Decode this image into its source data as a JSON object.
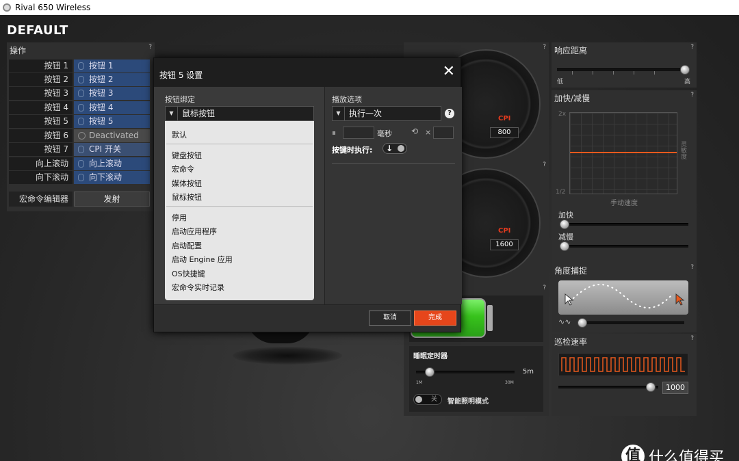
{
  "window": {
    "title": "Rival 650 Wireless"
  },
  "profile": {
    "name": "DEFAULT"
  },
  "help_glyph": "?",
  "operations": {
    "title": "操作",
    "rows": [
      {
        "label": "按钮 1",
        "value": "按钮 1"
      },
      {
        "label": "按钮 2",
        "value": "按钮 2"
      },
      {
        "label": "按钮 3",
        "value": "按钮 3"
      },
      {
        "label": "按钮 4",
        "value": "按钮 4"
      },
      {
        "label": "按钮 5",
        "value": "按钮 5"
      },
      {
        "label": "按钮 6",
        "value": "Deactivated"
      },
      {
        "label": "按钮 7",
        "value": "CPI 开关"
      },
      {
        "label": "向上滚动",
        "value": "向上滚动"
      },
      {
        "label": "向下滚动",
        "value": "向下滚动"
      }
    ],
    "macro_label": "宏命令编辑器",
    "macro_button": "发射"
  },
  "cpi": {
    "label": "CPI",
    "gauge1": "800",
    "gauge2": "1600"
  },
  "sleep": {
    "title": "睡眠定时器",
    "value": "5m",
    "min": "1M",
    "max": "30M",
    "toggle_text": "关",
    "smart_label": "智能照明模式",
    "level": 0.14
  },
  "response": {
    "title": "响应距离",
    "low": "低",
    "high": "高",
    "level": 1.0
  },
  "accel": {
    "title": "加快/减慢",
    "y_top": "2x",
    "y_bottom": "1/2",
    "x_label": "手动速度",
    "y_label": "灵敏度",
    "accel_label": "加快",
    "decel_label": "减慢"
  },
  "angle": {
    "title": "角度捕捉"
  },
  "polling": {
    "title": "巡检速率",
    "value": "1000"
  },
  "dialog": {
    "title": "按钮 5 设置",
    "close": "✕",
    "binding_label": "按钮绑定",
    "binding_value": "鼠标按钮",
    "dropdown_arrow": "▼",
    "dropdown_items": {
      "default": "默认",
      "keyboard": "键盘按钮",
      "macro": "宏命令",
      "media": "媒体按钮",
      "mouse": "鼠标按钮",
      "disable": "停用",
      "launch_app": "启动应用程序",
      "launch_config": "启动配置",
      "launch_engine": "启动 Engine 应用",
      "os_shortcut": "OS快捷键",
      "macro_live": "宏命令实时记录"
    },
    "playback_label": "播放选项",
    "playback_value": "执行一次",
    "ms_label": "毫秒",
    "repeat_x": "×",
    "exec_label": "按键时执行:",
    "cancel": "取消",
    "done": "完成"
  },
  "watermark": {
    "logo": "值",
    "text": "什么值得买"
  }
}
